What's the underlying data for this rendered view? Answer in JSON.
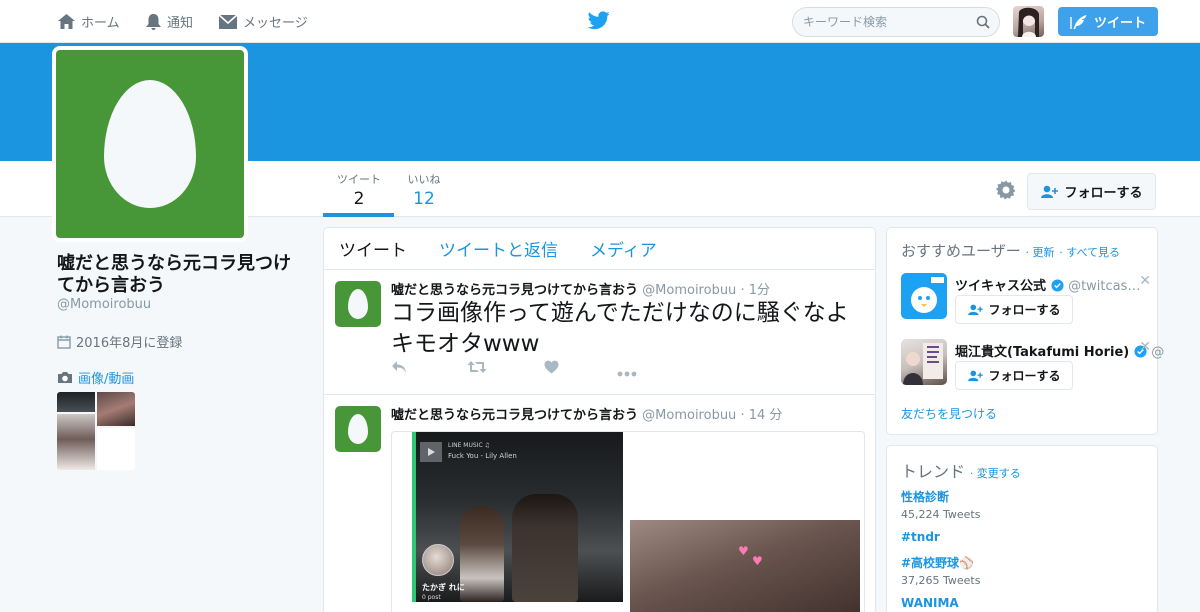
{
  "nav": {
    "home": "ホーム",
    "notifications": "通知",
    "messages": "メッセージ",
    "search_placeholder": "キーワード検索",
    "tweet_button": "ツイート"
  },
  "profile": {
    "name": "嘘だと思うなら元コラ見つけてから言おう",
    "handle": "@Momoirobuu",
    "joined": "2016年8月に登録",
    "media_link": "画像/動画",
    "stats": [
      {
        "label": "ツイート",
        "value": "2"
      },
      {
        "label": "いいね",
        "value": "12"
      }
    ],
    "follow_button": "フォローする"
  },
  "timeline": {
    "tabs": [
      "ツイート",
      "ツイートと返信",
      "メディア"
    ],
    "tweets": [
      {
        "name": "嘘だと思うなら元コラ見つけてから言おう",
        "handle": "@Momoirobuu",
        "time": "· 1分",
        "text": "コラ画像作って遊んでただけなのに騒ぐなよキモオタwww"
      },
      {
        "name": "嘘だと思うなら元コラ見つけてから言おう",
        "handle": "@Momoirobuu",
        "time": "· 14 分",
        "media": {
          "app_label": "LINE MUSIC ♫",
          "track": "Fuck You - Lily Allen",
          "caption_name": "たかぎ れに",
          "caption_posts": "0 post"
        }
      }
    ]
  },
  "who_to_follow": {
    "title": "おすすめユーザー",
    "refresh": "· 更新",
    "view_all": "· すべて見る",
    "users": [
      {
        "name": "ツイキャス公式",
        "handle": "@twitcas…",
        "follow": "フォローする"
      },
      {
        "name": "堀江貴文(Takafumi Horie)",
        "handle": "@",
        "follow": "フォローする"
      }
    ],
    "find_friends": "友だちを見つける"
  },
  "trends": {
    "title": "トレンド",
    "change": "· 変更する",
    "items": [
      {
        "name": "性格診断",
        "count": "45,224 Tweets"
      },
      {
        "name": "#tndr",
        "count": ""
      },
      {
        "name": "#高校野球⚾",
        "count": "37,265 Tweets"
      },
      {
        "name": "WANIMA",
        "count": ""
      }
    ]
  },
  "colors": {
    "accent": "#1b95e0",
    "banner": "#1b95e0",
    "avatar_bg": "#479738",
    "tweet_button": "#3ea1ec"
  }
}
